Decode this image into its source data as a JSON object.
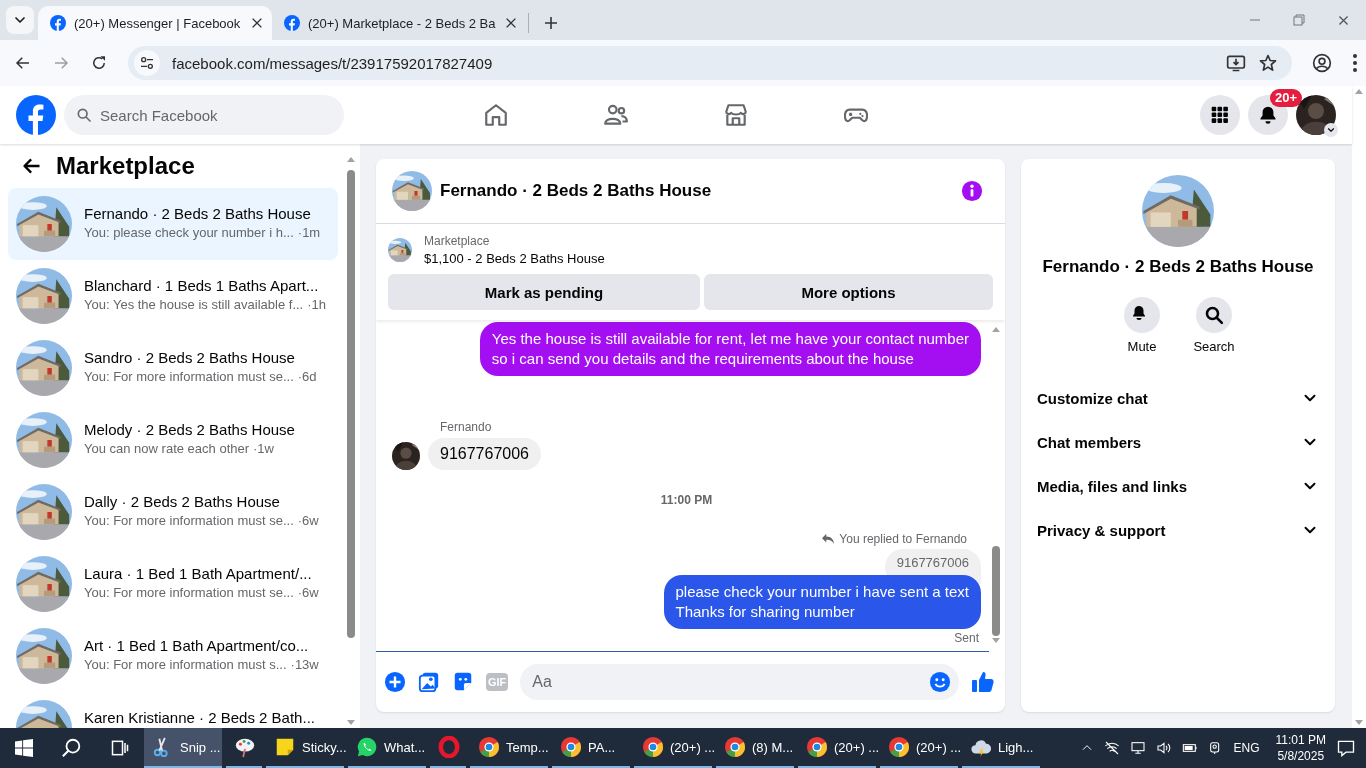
{
  "browser": {
    "tabs": [
      {
        "title": "(20+) Messenger | Facebook",
        "selected": true
      },
      {
        "title": "(20+) Marketplace - 2 Beds 2 Ba",
        "selected": false
      }
    ],
    "url": "facebook.com/messages/t/23917592017827409"
  },
  "topbar": {
    "search": {
      "placeholder": "Search Facebook"
    },
    "notifications_badge": "20+"
  },
  "sidebar": {
    "title": "Marketplace",
    "conversations": [
      {
        "title": "Fernando · 2 Beds 2 Baths House",
        "preview": "You: please check your number i h...",
        "time": "·1m",
        "selected": true
      },
      {
        "title": "Blanchard · 1 Beds 1 Baths Apart...",
        "preview": "You: Yes the house is still available f...",
        "time": "·1h",
        "selected": false
      },
      {
        "title": "Sandro · 2 Beds 2 Baths House",
        "preview": "You: For more information must se...",
        "time": "·6d",
        "selected": false
      },
      {
        "title": "Melody · 2 Beds 2 Baths House",
        "preview": "You can now rate each other",
        "time": "·1w",
        "selected": false
      },
      {
        "title": "Dally · 2 Beds 2 Baths House",
        "preview": "You: For more information must se...",
        "time": "·6w",
        "selected": false
      },
      {
        "title": "Laura · 1 Bed 1 Bath Apartment/...",
        "preview": "You: For more information must se...",
        "time": "·6w",
        "selected": false
      },
      {
        "title": "Art · 1 Bed 1 Bath Apartment/co...",
        "preview": "You: For more information must s...",
        "time": "·13w",
        "selected": false
      },
      {
        "title": "Karen Kristianne · 2 Beds 2 Bath...",
        "selected": false
      }
    ]
  },
  "chat": {
    "title": "Fernando · 2 Beds 2 Baths House",
    "listing": {
      "source": "Marketplace",
      "summary": "$1,100 - 2 Beds 2 Baths House"
    },
    "buttons": [
      "Mark as pending",
      "More options"
    ],
    "messages": [
      {
        "kind": "outgoing",
        "text": "Yes the house is still available for rent, let me have your contact number\nso i can send you details and the requirements about the house",
        "color": "#a40ff2"
      },
      {
        "kind": "incoming",
        "sender": "Fernando",
        "text": "9167767006"
      },
      {
        "kind": "timestamp",
        "text": "11:00 PM"
      },
      {
        "kind": "reply",
        "note": "You replied to Fernando",
        "quote": "9167767006",
        "text": "please check your number i have sent a text\nThanks for sharing number",
        "color": "#2a56ea",
        "status": "Sent"
      }
    ],
    "composer": {
      "gif": "GIF",
      "placeholder": "Aa"
    }
  },
  "info_panel": {
    "title": "Fernando · 2 Beds 2 Baths House",
    "actions": [
      {
        "kind": "mute",
        "label": "Mute"
      },
      {
        "kind": "search",
        "label": "Search"
      }
    ],
    "sections": [
      {
        "label": "Customize chat",
        "expanded": false
      },
      {
        "label": "Chat members",
        "expanded": false
      },
      {
        "label": "Media, files and links",
        "expanded": false
      },
      {
        "label": "Privacy & support",
        "expanded": false
      }
    ]
  },
  "taskbar": {
    "apps": [
      {
        "kind": "snip",
        "label": "Snip ...",
        "selected": true
      },
      {
        "kind": "paint",
        "selected": false
      },
      {
        "kind": "sticky",
        "label": "Sticky...",
        "selected": false
      },
      {
        "kind": "whatsapp",
        "label": "What...",
        "selected": false
      },
      {
        "kind": "opera",
        "selected": false
      },
      {
        "kind": "chrome",
        "label": "Temp...",
        "selected": false
      },
      {
        "kind": "chrome",
        "label": "PA...",
        "selected": false
      },
      {
        "kind": "chrome",
        "label": "(20+) ...",
        "selected": false
      },
      {
        "kind": "chrome",
        "label": "(8) M...",
        "selected": false
      },
      {
        "kind": "chrome",
        "label": "(20+) ...",
        "selected": false
      },
      {
        "kind": "chrome",
        "label": "(20+) ...",
        "selected": false
      },
      {
        "kind": "weather",
        "label": "Ligh...",
        "selected": false
      }
    ],
    "tray": {
      "language": "ENG",
      "time": "11:01 PM",
      "date": "5/8/2025"
    }
  }
}
